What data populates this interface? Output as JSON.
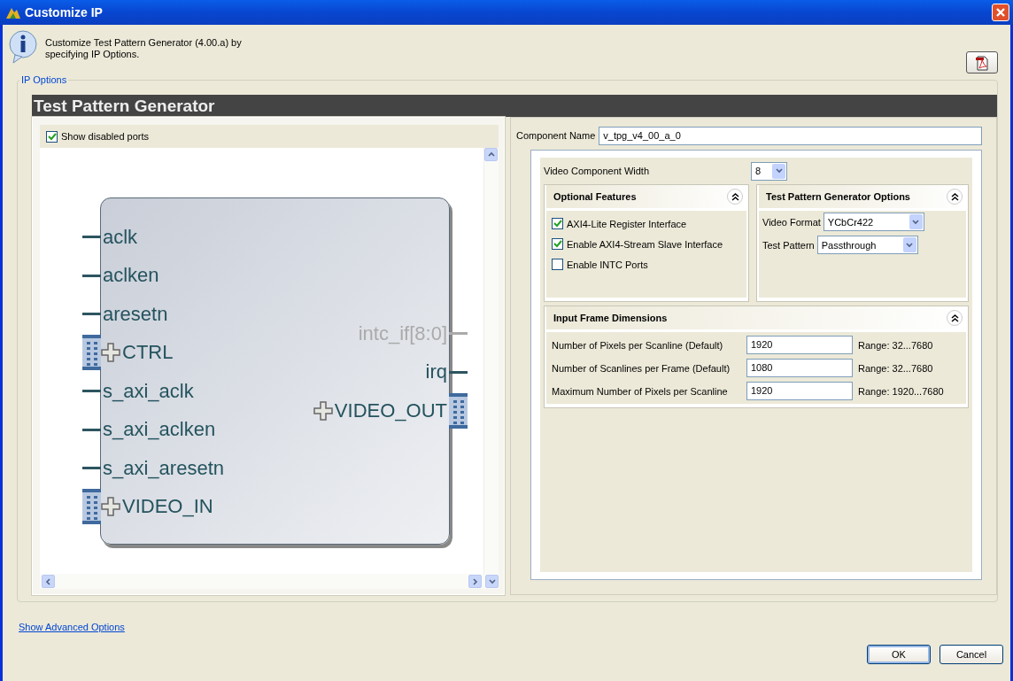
{
  "window": {
    "title": "Customize IP"
  },
  "header": {
    "description": "Customize Test Pattern Generator (4.00.a) by specifying IP Options."
  },
  "ip_options": {
    "legend": "IP Options",
    "title": "Test Pattern Generator"
  },
  "symbol_panel": {
    "show_disabled_ports": {
      "label": "Show disabled ports",
      "checked": true
    },
    "ports_left": [
      {
        "name": "aclk",
        "kind": "wire",
        "disabled": false
      },
      {
        "name": "aclken",
        "kind": "wire",
        "disabled": false
      },
      {
        "name": "aresetn",
        "kind": "wire",
        "disabled": false
      },
      {
        "name": "CTRL",
        "kind": "bus",
        "disabled": false
      },
      {
        "name": "s_axi_aclk",
        "kind": "wire",
        "disabled": false
      },
      {
        "name": "s_axi_aclken",
        "kind": "wire",
        "disabled": false
      },
      {
        "name": "s_axi_aresetn",
        "kind": "wire",
        "disabled": false
      },
      {
        "name": "VIDEO_IN",
        "kind": "bus",
        "disabled": false
      }
    ],
    "ports_right": [
      {
        "name": "intc_if[8:0]",
        "kind": "wire",
        "disabled": true
      },
      {
        "name": "irq",
        "kind": "wire",
        "disabled": false
      },
      {
        "name": "VIDEO_OUT",
        "kind": "bus",
        "disabled": false
      }
    ]
  },
  "config_panel": {
    "component_name": {
      "label": "Component Name",
      "value": "v_tpg_v4_00_a_0"
    },
    "video_component_width": {
      "label": "Video Component Width",
      "value": "8"
    },
    "optional_features": {
      "title": "Optional Features",
      "expanded": true,
      "options": [
        {
          "label": "AXI4-Lite Register Interface",
          "checked": true
        },
        {
          "label": "Enable AXI4-Stream Slave Interface",
          "checked": true
        },
        {
          "label": "Enable INTC Ports",
          "checked": false
        }
      ]
    },
    "tpg_options": {
      "title": "Test Pattern Generator Options",
      "expanded": true,
      "fields": [
        {
          "label": "Video Format",
          "value": "YCbCr422"
        },
        {
          "label": "Test Pattern",
          "value": "Passthrough"
        }
      ]
    },
    "input_frame_dimensions": {
      "title": "Input Frame Dimensions",
      "expanded": true,
      "rows": [
        {
          "label": "Number of Pixels per Scanline (Default)",
          "value": "1920",
          "range": "Range: 32...7680"
        },
        {
          "label": "Number of Scanlines per Frame (Default)",
          "value": "1080",
          "range": "Range: 32...7680"
        },
        {
          "label": "Maximum Number of Pixels per Scanline",
          "value": "1920",
          "range": "Range: 1920...7680"
        }
      ]
    }
  },
  "footer": {
    "link": "Show Advanced Options",
    "buttons": [
      {
        "label": "OK",
        "default": true
      },
      {
        "label": "Cancel",
        "default": false
      }
    ]
  }
}
